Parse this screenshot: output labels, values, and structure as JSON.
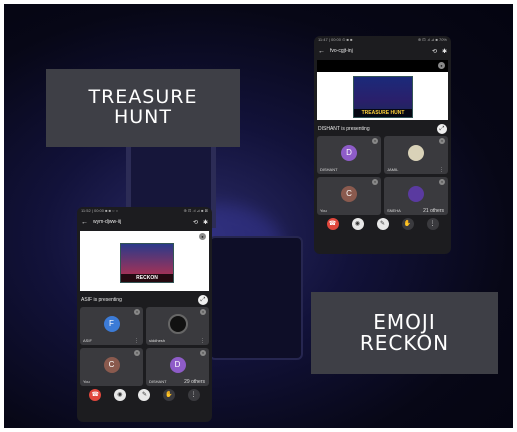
{
  "captions": {
    "treasure_hunt": [
      "TREASURE",
      "HUNT"
    ],
    "emoji_reckon": [
      "EMOJI",
      "RECKON"
    ]
  },
  "phone_a": {
    "status_left": "11:47 | 00:00 ⊙ ■ ■",
    "status_right": "⊕ ⊡ .ıl ⊿ ■ 70%",
    "meeting_code": "fvo-cgjt-inj",
    "poster_text": "TREASURE HUNT",
    "presenting_label": "DISHANT is presenting",
    "tiles": [
      {
        "name": "DISHANT",
        "initial": "D",
        "color": "#8e5cc8",
        "more": ""
      },
      {
        "name": "JAMIL",
        "initial": "",
        "color": "#d9d2b8",
        "more": "⋮"
      },
      {
        "name": "You",
        "initial": "C",
        "color": "#8a5a4e",
        "more": ""
      },
      {
        "name": "SNEHA",
        "initial": "",
        "color": "#5a3aa0",
        "more": "21 others"
      }
    ]
  },
  "phone_b": {
    "status_left": "11:52 | 00:00 ■ ■ ○ ○",
    "status_right": "⊕ ⊡ .ıl ⊿ ■ ⊠",
    "meeting_code": "wym-djww-iij",
    "poster_text": "RECKON",
    "presenting_label": "ASIF is presenting",
    "tiles": [
      {
        "name": "ASIF",
        "initial": "F",
        "color": "#3c7bd6",
        "more": "⋮"
      },
      {
        "name": "siddhesh",
        "initial": "",
        "color": "#111111",
        "more": "⋮"
      },
      {
        "name": "You",
        "initial": "C",
        "color": "#8a5a4e",
        "more": ""
      },
      {
        "name": "DISHANT",
        "initial": "D",
        "color": "#8e5cc8",
        "more": "29 others"
      }
    ]
  },
  "icons": {
    "back": "←",
    "switch_camera": "⟲",
    "bluetooth": "✱",
    "end_call": "☎",
    "camera_off": "◉",
    "mic_off": "✎",
    "raise_hand": "✋",
    "more": "⋮",
    "fullscreen": "⤢"
  }
}
